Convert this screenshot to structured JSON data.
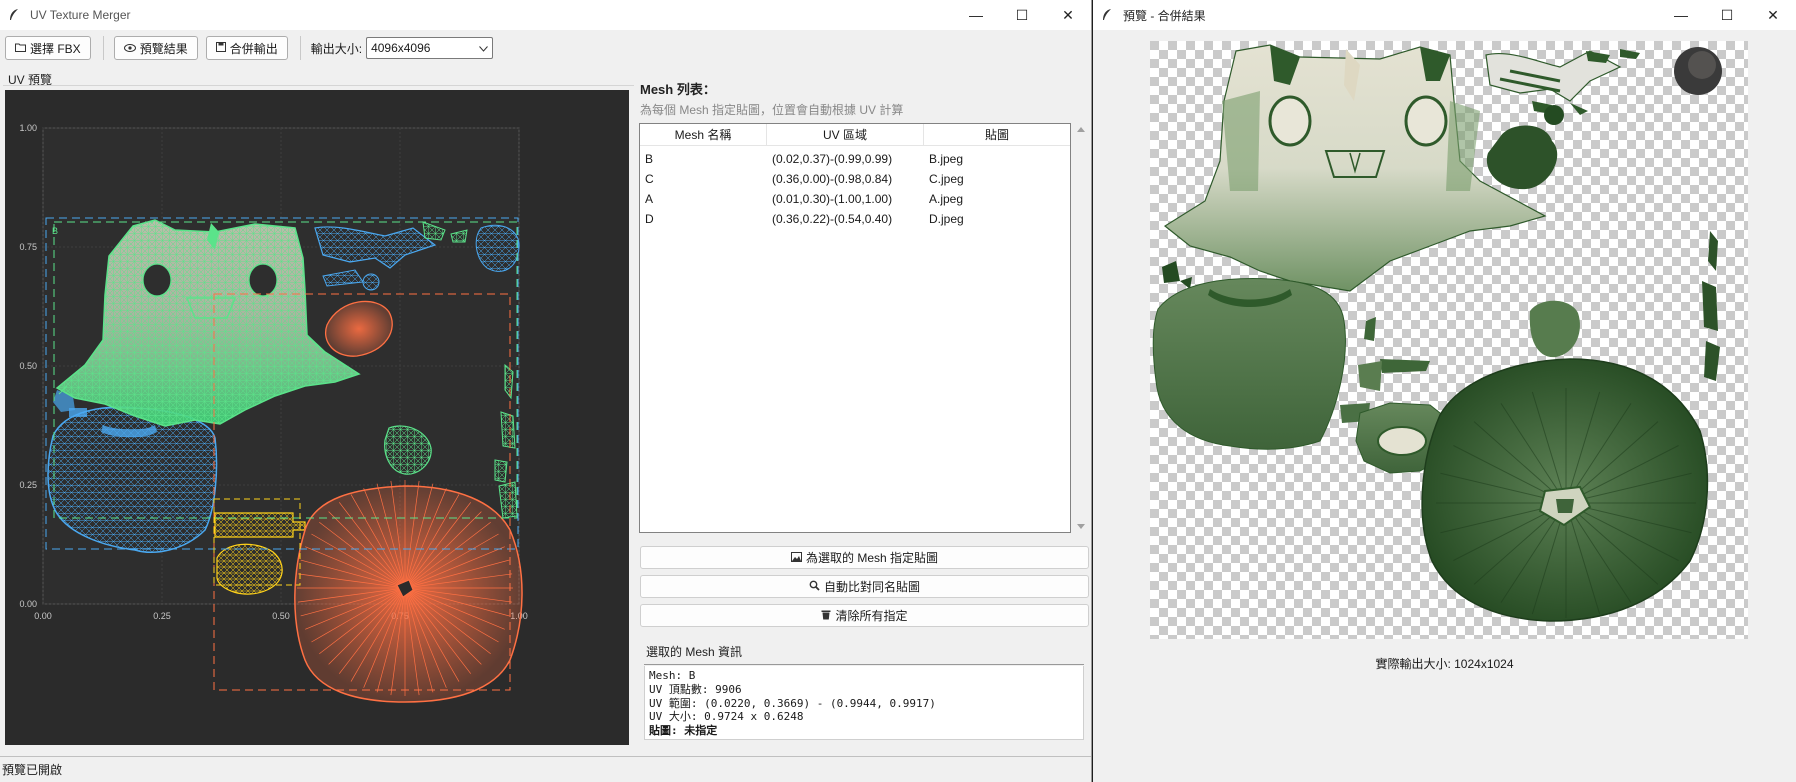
{
  "main_window": {
    "title": "UV Texture Merger",
    "controls": {
      "minimize": "—",
      "maximize": "☐",
      "close": "✕"
    }
  },
  "toolbar": {
    "select_fbx": "選擇 FBX",
    "preview": "預覽結果",
    "merge_export": "合併輸出",
    "output_size_label": "輸出大小:",
    "output_size_value": "4096x4096"
  },
  "uv_panel": {
    "label": "UV 預覽",
    "x_ticks": [
      "0.00",
      "0.25",
      "0.50",
      "0.75",
      "1.00"
    ],
    "y_ticks": [
      "1.00",
      "0.75",
      "0.50",
      "0.25",
      "0.00"
    ],
    "box_label": "B",
    "colors": {
      "B": "#5be38a",
      "A": "#4aa8f0",
      "C": "#ff7043",
      "D": "#ffd21a"
    }
  },
  "mesh_list": {
    "title": "Mesh 列表：",
    "hint": "為每個 Mesh 指定貼圖，位置會自動根據 UV 計算",
    "columns": [
      "Mesh 名稱",
      "UV 區域",
      "貼圖"
    ],
    "rows": [
      {
        "name": "B",
        "region": "(0.02,0.37)-(0.99,0.99)",
        "texture": "B.jpeg"
      },
      {
        "name": "C",
        "region": "(0.36,0.00)-(0.98,0.84)",
        "texture": "C.jpeg"
      },
      {
        "name": "A",
        "region": "(0.01,0.30)-(1.00,1.00)",
        "texture": "A.jpeg"
      },
      {
        "name": "D",
        "region": "(0.36,0.22)-(0.54,0.40)",
        "texture": "D.jpeg"
      }
    ]
  },
  "actions": {
    "assign": "為選取的 Mesh 指定貼圖",
    "auto_match": "自動比對同名貼圖",
    "clear_all": "清除所有指定"
  },
  "selected_info": {
    "label": "選取的 Mesh 資訊",
    "lines": [
      "Mesh: B",
      "UV 頂點數: 9906",
      "UV 範圍: (0.0220, 0.3669) - (0.9944, 0.9917)",
      "UV 大小: 0.9724 x 0.6248",
      "貼圖: 未指定"
    ]
  },
  "status_bar": "預覽已開啟",
  "preview_window": {
    "title": "預覽 - 合併結果",
    "footer": "實際輸出大小: 1024x1024",
    "controls": {
      "minimize": "—",
      "maximize": "☐",
      "close": "✕"
    }
  }
}
